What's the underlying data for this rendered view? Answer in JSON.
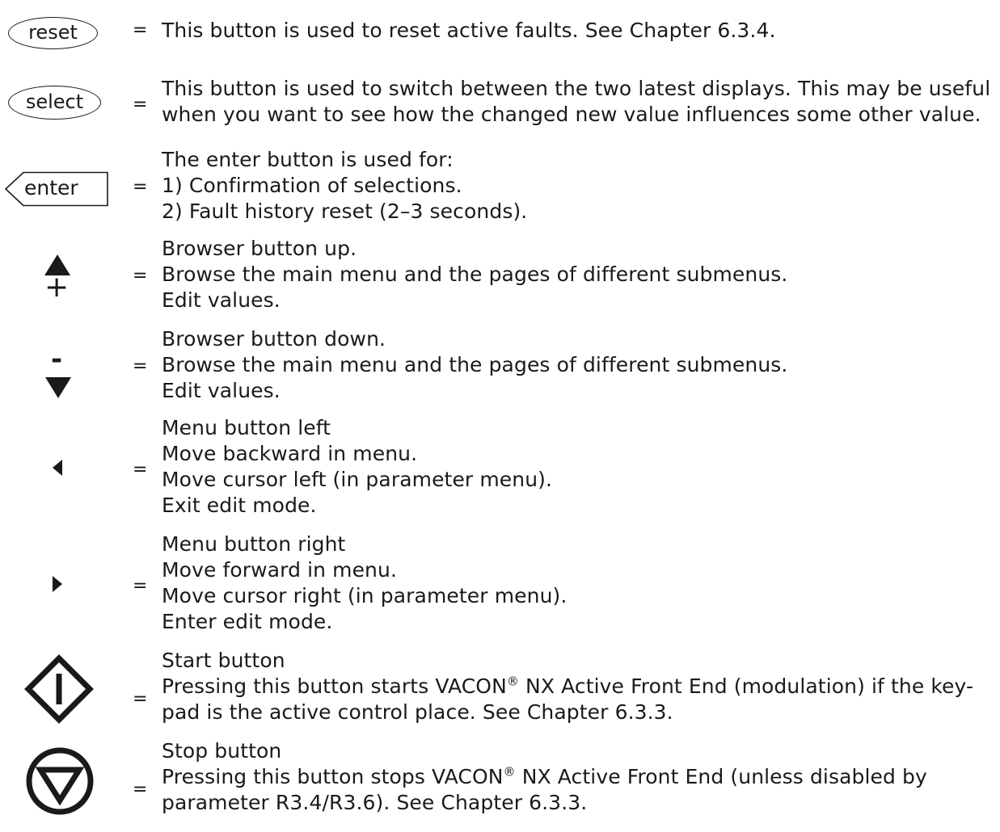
{
  "equals": "=",
  "items": [
    {
      "id": "reset",
      "icon": "reset-button-icon",
      "label": "reset",
      "lines": [
        "This button is used to reset active faults. See Chapter 6.3.4."
      ]
    },
    {
      "id": "select",
      "icon": "select-button-icon",
      "label": "select",
      "lines": [
        "This button is used to switch between the two latest displays. This may be useful",
        "when you want to see how the changed new value influences some other value."
      ]
    },
    {
      "id": "enter",
      "icon": "enter-button-icon",
      "label": "enter",
      "lines": [
        "The enter button is used for:",
        "1) Confirmation of selections.",
        "2) Fault history reset (2–3 seconds)."
      ]
    },
    {
      "id": "up",
      "icon": "browser-up-icon",
      "label": "+",
      "lines": [
        "Browser button up.",
        "Browse the main menu and the pages of different submenus.",
        "Edit values."
      ]
    },
    {
      "id": "down",
      "icon": "browser-down-icon",
      "label": "-",
      "lines": [
        "Browser button down.",
        "Browse the main menu and the pages of different submenus.",
        "Edit values."
      ]
    },
    {
      "id": "left",
      "icon": "menu-left-icon",
      "lines": [
        "Menu button left",
        "Move backward in menu.",
        "Move cursor left (in parameter menu).",
        "Exit edit mode."
      ]
    },
    {
      "id": "right",
      "icon": "menu-right-icon",
      "lines": [
        "Menu button right",
        "Move forward in menu.",
        "Move cursor right (in parameter menu).",
        "Enter edit mode."
      ]
    },
    {
      "id": "start",
      "icon": "start-button-icon",
      "lines": [
        "Start button",
        "Pressing this button starts VACON",
        "® NX Active Front End (modulation) if the key-",
        "pad is the active control place. See Chapter 6.3.3."
      ]
    },
    {
      "id": "stop",
      "icon": "stop-button-icon",
      "lines": [
        "Stop button",
        "Pressing this button stops VACON",
        "® NX Active Front End (unless disabled by",
        "parameter R3.4/R3.6). See Chapter 6.3.3."
      ]
    }
  ]
}
